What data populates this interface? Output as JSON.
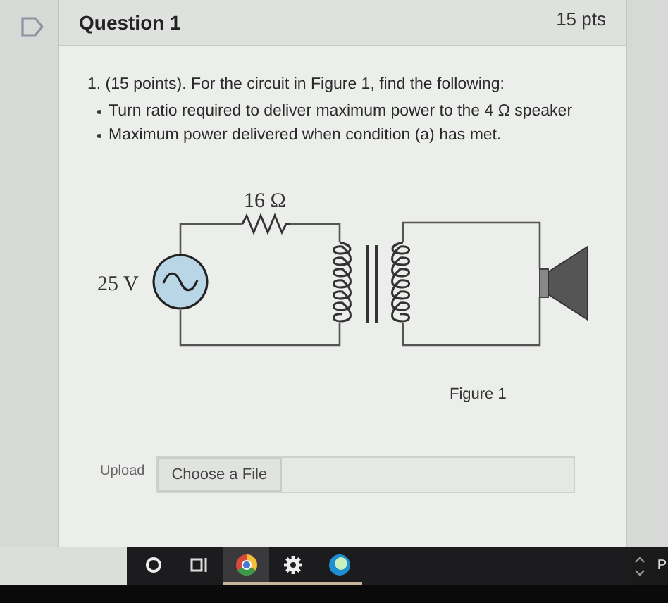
{
  "question": {
    "title": "Question 1",
    "points": "15 pts",
    "flagged": false
  },
  "prompt": "1. (15 points). For the circuit in Figure 1, find the following:",
  "bullets": [
    "Turn ratio required to deliver maximum power to the 4 Ω speaker",
    "Maximum power delivered when condition (a) has met."
  ],
  "figure": {
    "resistor_label": "16 Ω",
    "source_label": "25 V",
    "caption": "Figure 1"
  },
  "upload": {
    "label": "Upload",
    "button": "Choose a File"
  },
  "taskbar": {
    "items": [
      {
        "kind": "circle",
        "running": false,
        "selected": false
      },
      {
        "kind": "taskview",
        "running": false,
        "selected": false
      },
      {
        "kind": "browser",
        "running": true,
        "selected": true
      },
      {
        "kind": "gear",
        "running": true,
        "selected": false
      },
      {
        "kind": "orb",
        "running": true,
        "selected": false
      }
    ],
    "edge_text": "P"
  }
}
